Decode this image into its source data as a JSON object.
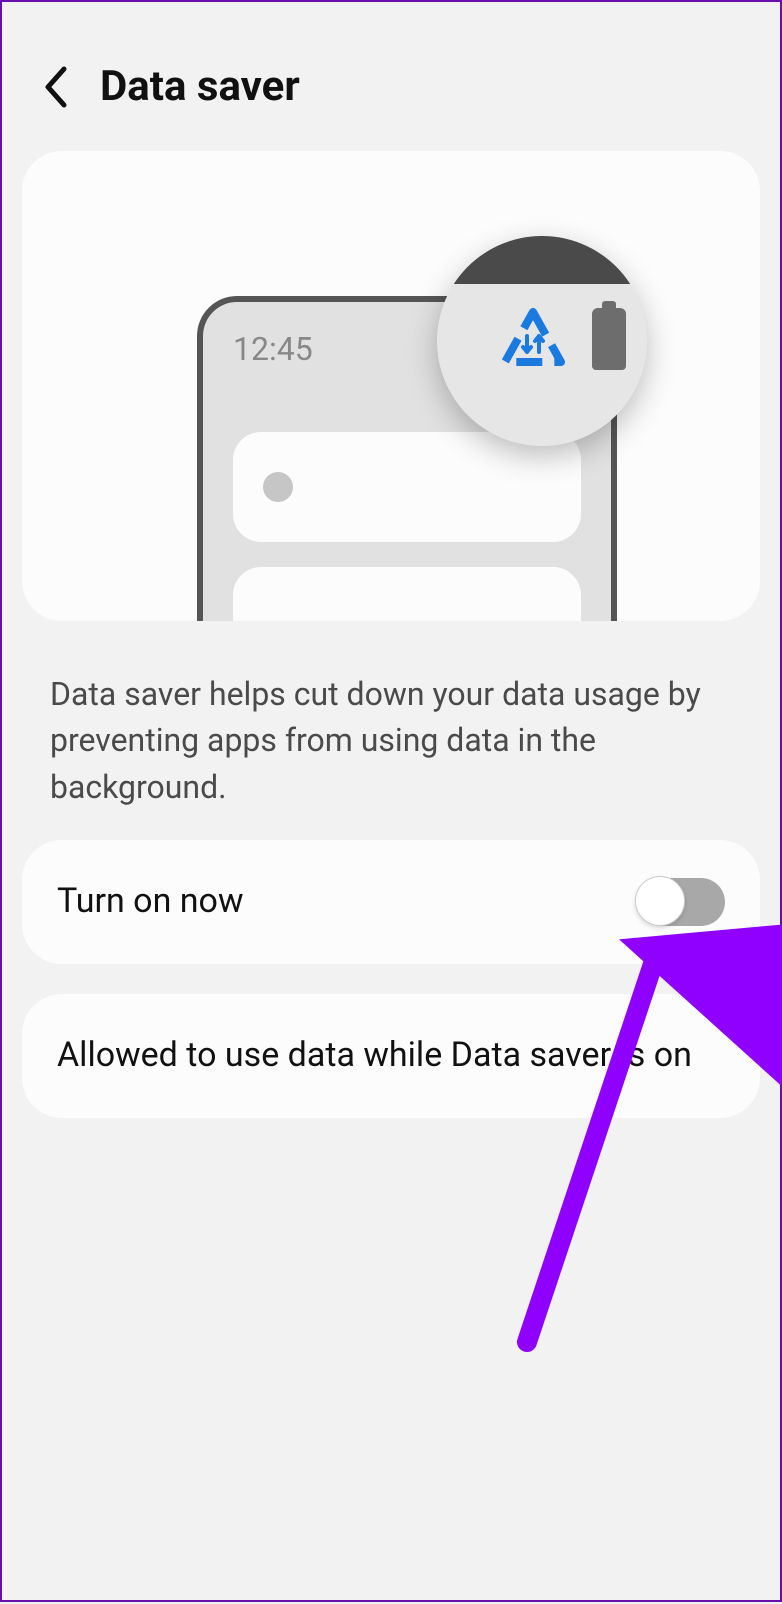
{
  "header": {
    "title": "Data saver"
  },
  "illustration": {
    "time": "12:45"
  },
  "description": "Data saver helps cut down your data usage by preventing apps from using data in the background.",
  "settings": {
    "toggle_label": "Turn on now",
    "toggle_on": false,
    "allowed_label": "Allowed to use data while Data saver is on"
  },
  "annotation": {
    "arrow_color": "#8f00ff"
  }
}
